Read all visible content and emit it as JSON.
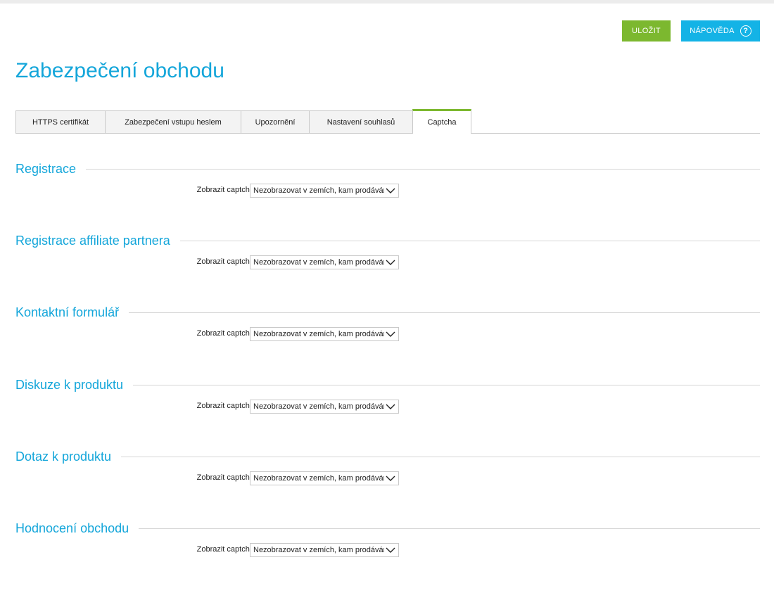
{
  "toolbar": {
    "save_label": "ULOŽIT",
    "help_label": "NÁPOVĚDA",
    "help_icon_glyph": "?"
  },
  "page": {
    "title": "Zabezpečení obchodu"
  },
  "tabs": [
    {
      "label": "HTTPS certifikát",
      "active": false
    },
    {
      "label": "Zabezpečení vstupu heslem",
      "active": false
    },
    {
      "label": "Upozornění",
      "active": false
    },
    {
      "label": "Nastavení souhlasů",
      "active": false
    },
    {
      "label": "Captcha",
      "active": true
    }
  ],
  "sections": [
    {
      "title": "Registrace",
      "field_label": "Zobrazit captchu:",
      "value": "Nezobrazovat v zemích, kam prodáváme"
    },
    {
      "title": "Registrace affiliate partnera",
      "field_label": "Zobrazit captchu:",
      "value": "Nezobrazovat v zemích, kam prodáváme"
    },
    {
      "title": "Kontaktní formulář",
      "field_label": "Zobrazit captchu:",
      "value": "Nezobrazovat v zemích, kam prodáváme"
    },
    {
      "title": "Diskuze k produktu",
      "field_label": "Zobrazit captchu:",
      "value": "Nezobrazovat v zemích, kam prodáváme"
    },
    {
      "title": "Dotaz k produktu",
      "field_label": "Zobrazit captchu:",
      "value": "Nezobrazovat v zemích, kam prodáváme"
    },
    {
      "title": "Hodnocení obchodu",
      "field_label": "Zobrazit captchu:",
      "value": "Nezobrazovat v zemích, kam prodáváme"
    }
  ],
  "colors": {
    "accent_blue": "#14a6da",
    "save_green": "#7cb82f",
    "help_blue": "#14b3e6"
  }
}
